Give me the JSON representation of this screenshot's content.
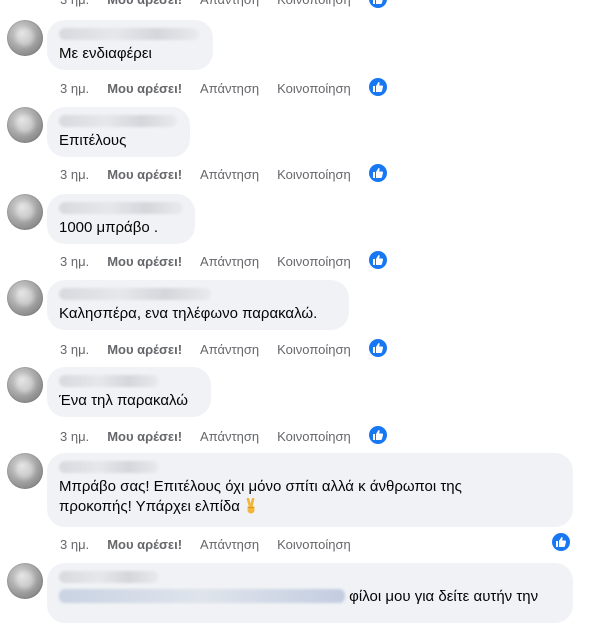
{
  "actions": {
    "time": "3 ημ.",
    "like": "Μου αρέσει!",
    "reply": "Απάντηση",
    "share": "Κοινοποίηση"
  },
  "comments": [
    {
      "text": "Με ενδιαφέρει"
    },
    {
      "text": "Επιτέλους"
    },
    {
      "text": "1000 μπράβο ."
    },
    {
      "text": "Καλησπέρα, ενα τηλέφωνο παρακαλώ."
    },
    {
      "text": "Ένα τηλ παρακαλώ"
    },
    {
      "text_line1": "Μπράβο σας! Επιτέλους όχι μόνο σπίτι αλλά κ άνθρωποι της",
      "text_line2": "προκοπής! Υπάρχει ελπίδα"
    },
    {
      "text_visible": "φίλοι μου για δείτε αυτήν την"
    }
  ],
  "colors": {
    "accent": "#1877f2",
    "bubble": "#f0f2f5",
    "meta": "#65676b"
  },
  "icons": {
    "reaction": "thumbs-up-icon",
    "emoji": "victory-hand-icon"
  }
}
